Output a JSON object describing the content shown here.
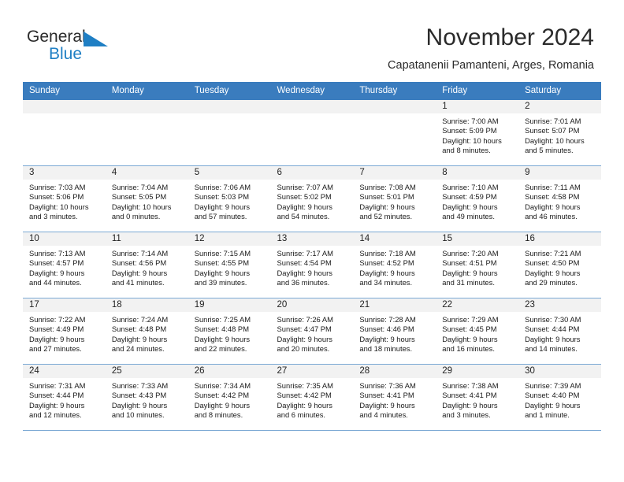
{
  "brand": {
    "line1": "General",
    "line2": "Blue",
    "mark": "triangle-logo",
    "accent": "#1f7fc4"
  },
  "header": {
    "title": "November 2024",
    "subtitle": "Capatanenii Pamanteni, Arges, Romania"
  },
  "colors": {
    "header_row_bg": "#3a7cbe",
    "day_band_bg": "#f2f2f2",
    "grid_line": "#7ba9d4"
  },
  "weekdays": [
    "Sunday",
    "Monday",
    "Tuesday",
    "Wednesday",
    "Thursday",
    "Friday",
    "Saturday"
  ],
  "labels": {
    "sunrise": "Sunrise:",
    "sunset": "Sunset:",
    "daylight": "Daylight:"
  },
  "weeks": [
    [
      {
        "day": "",
        "empty": true
      },
      {
        "day": "",
        "empty": true
      },
      {
        "day": "",
        "empty": true
      },
      {
        "day": "",
        "empty": true
      },
      {
        "day": "",
        "empty": true
      },
      {
        "day": "1",
        "sunrise": "Sunrise: 7:00 AM",
        "sunset": "Sunset: 5:09 PM",
        "daylight_l1": "Daylight: 10 hours",
        "daylight_l2": "and 8 minutes."
      },
      {
        "day": "2",
        "sunrise": "Sunrise: 7:01 AM",
        "sunset": "Sunset: 5:07 PM",
        "daylight_l1": "Daylight: 10 hours",
        "daylight_l2": "and 5 minutes."
      }
    ],
    [
      {
        "day": "3",
        "sunrise": "Sunrise: 7:03 AM",
        "sunset": "Sunset: 5:06 PM",
        "daylight_l1": "Daylight: 10 hours",
        "daylight_l2": "and 3 minutes."
      },
      {
        "day": "4",
        "sunrise": "Sunrise: 7:04 AM",
        "sunset": "Sunset: 5:05 PM",
        "daylight_l1": "Daylight: 10 hours",
        "daylight_l2": "and 0 minutes."
      },
      {
        "day": "5",
        "sunrise": "Sunrise: 7:06 AM",
        "sunset": "Sunset: 5:03 PM",
        "daylight_l1": "Daylight: 9 hours",
        "daylight_l2": "and 57 minutes."
      },
      {
        "day": "6",
        "sunrise": "Sunrise: 7:07 AM",
        "sunset": "Sunset: 5:02 PM",
        "daylight_l1": "Daylight: 9 hours",
        "daylight_l2": "and 54 minutes."
      },
      {
        "day": "7",
        "sunrise": "Sunrise: 7:08 AM",
        "sunset": "Sunset: 5:01 PM",
        "daylight_l1": "Daylight: 9 hours",
        "daylight_l2": "and 52 minutes."
      },
      {
        "day": "8",
        "sunrise": "Sunrise: 7:10 AM",
        "sunset": "Sunset: 4:59 PM",
        "daylight_l1": "Daylight: 9 hours",
        "daylight_l2": "and 49 minutes."
      },
      {
        "day": "9",
        "sunrise": "Sunrise: 7:11 AM",
        "sunset": "Sunset: 4:58 PM",
        "daylight_l1": "Daylight: 9 hours",
        "daylight_l2": "and 46 minutes."
      }
    ],
    [
      {
        "day": "10",
        "sunrise": "Sunrise: 7:13 AM",
        "sunset": "Sunset: 4:57 PM",
        "daylight_l1": "Daylight: 9 hours",
        "daylight_l2": "and 44 minutes."
      },
      {
        "day": "11",
        "sunrise": "Sunrise: 7:14 AM",
        "sunset": "Sunset: 4:56 PM",
        "daylight_l1": "Daylight: 9 hours",
        "daylight_l2": "and 41 minutes."
      },
      {
        "day": "12",
        "sunrise": "Sunrise: 7:15 AM",
        "sunset": "Sunset: 4:55 PM",
        "daylight_l1": "Daylight: 9 hours",
        "daylight_l2": "and 39 minutes."
      },
      {
        "day": "13",
        "sunrise": "Sunrise: 7:17 AM",
        "sunset": "Sunset: 4:54 PM",
        "daylight_l1": "Daylight: 9 hours",
        "daylight_l2": "and 36 minutes."
      },
      {
        "day": "14",
        "sunrise": "Sunrise: 7:18 AM",
        "sunset": "Sunset: 4:52 PM",
        "daylight_l1": "Daylight: 9 hours",
        "daylight_l2": "and 34 minutes."
      },
      {
        "day": "15",
        "sunrise": "Sunrise: 7:20 AM",
        "sunset": "Sunset: 4:51 PM",
        "daylight_l1": "Daylight: 9 hours",
        "daylight_l2": "and 31 minutes."
      },
      {
        "day": "16",
        "sunrise": "Sunrise: 7:21 AM",
        "sunset": "Sunset: 4:50 PM",
        "daylight_l1": "Daylight: 9 hours",
        "daylight_l2": "and 29 minutes."
      }
    ],
    [
      {
        "day": "17",
        "sunrise": "Sunrise: 7:22 AM",
        "sunset": "Sunset: 4:49 PM",
        "daylight_l1": "Daylight: 9 hours",
        "daylight_l2": "and 27 minutes."
      },
      {
        "day": "18",
        "sunrise": "Sunrise: 7:24 AM",
        "sunset": "Sunset: 4:48 PM",
        "daylight_l1": "Daylight: 9 hours",
        "daylight_l2": "and 24 minutes."
      },
      {
        "day": "19",
        "sunrise": "Sunrise: 7:25 AM",
        "sunset": "Sunset: 4:48 PM",
        "daylight_l1": "Daylight: 9 hours",
        "daylight_l2": "and 22 minutes."
      },
      {
        "day": "20",
        "sunrise": "Sunrise: 7:26 AM",
        "sunset": "Sunset: 4:47 PM",
        "daylight_l1": "Daylight: 9 hours",
        "daylight_l2": "and 20 minutes."
      },
      {
        "day": "21",
        "sunrise": "Sunrise: 7:28 AM",
        "sunset": "Sunset: 4:46 PM",
        "daylight_l1": "Daylight: 9 hours",
        "daylight_l2": "and 18 minutes."
      },
      {
        "day": "22",
        "sunrise": "Sunrise: 7:29 AM",
        "sunset": "Sunset: 4:45 PM",
        "daylight_l1": "Daylight: 9 hours",
        "daylight_l2": "and 16 minutes."
      },
      {
        "day": "23",
        "sunrise": "Sunrise: 7:30 AM",
        "sunset": "Sunset: 4:44 PM",
        "daylight_l1": "Daylight: 9 hours",
        "daylight_l2": "and 14 minutes."
      }
    ],
    [
      {
        "day": "24",
        "sunrise": "Sunrise: 7:31 AM",
        "sunset": "Sunset: 4:44 PM",
        "daylight_l1": "Daylight: 9 hours",
        "daylight_l2": "and 12 minutes."
      },
      {
        "day": "25",
        "sunrise": "Sunrise: 7:33 AM",
        "sunset": "Sunset: 4:43 PM",
        "daylight_l1": "Daylight: 9 hours",
        "daylight_l2": "and 10 minutes."
      },
      {
        "day": "26",
        "sunrise": "Sunrise: 7:34 AM",
        "sunset": "Sunset: 4:42 PM",
        "daylight_l1": "Daylight: 9 hours",
        "daylight_l2": "and 8 minutes."
      },
      {
        "day": "27",
        "sunrise": "Sunrise: 7:35 AM",
        "sunset": "Sunset: 4:42 PM",
        "daylight_l1": "Daylight: 9 hours",
        "daylight_l2": "and 6 minutes."
      },
      {
        "day": "28",
        "sunrise": "Sunrise: 7:36 AM",
        "sunset": "Sunset: 4:41 PM",
        "daylight_l1": "Daylight: 9 hours",
        "daylight_l2": "and 4 minutes."
      },
      {
        "day": "29",
        "sunrise": "Sunrise: 7:38 AM",
        "sunset": "Sunset: 4:41 PM",
        "daylight_l1": "Daylight: 9 hours",
        "daylight_l2": "and 3 minutes."
      },
      {
        "day": "30",
        "sunrise": "Sunrise: 7:39 AM",
        "sunset": "Sunset: 4:40 PM",
        "daylight_l1": "Daylight: 9 hours",
        "daylight_l2": "and 1 minute."
      }
    ]
  ]
}
